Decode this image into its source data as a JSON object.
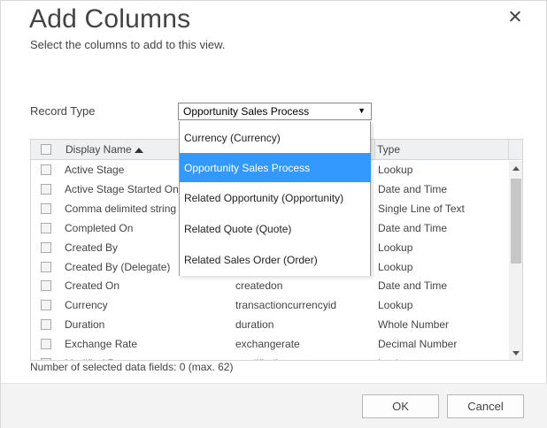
{
  "dialog": {
    "title": "Add Columns",
    "subtitle": "Select the columns to add to this view.",
    "close_icon": "close-icon"
  },
  "record_type": {
    "label": "Record Type",
    "selected": "Opportunity Sales Process",
    "options": [
      "Currency (Currency)",
      "Opportunity Sales Process",
      "Related Opportunity (Opportunity)",
      "Related Quote (Quote)",
      "Related Sales Order (Order)"
    ]
  },
  "grid": {
    "headers": {
      "display_name": "Display Name",
      "type": "Type"
    },
    "rows": [
      {
        "name": "Active Stage",
        "schema": "",
        "type": "Lookup"
      },
      {
        "name": "Active Stage Started On",
        "schema": "",
        "type": "Date and Time"
      },
      {
        "name": "Comma delimited string",
        "schema": "",
        "type": "Single Line of Text"
      },
      {
        "name": "Completed On",
        "schema": "",
        "type": "Date and Time"
      },
      {
        "name": "Created By",
        "schema": "",
        "type": "Lookup"
      },
      {
        "name": "Created By (Delegate)",
        "schema": "",
        "type": "Lookup"
      },
      {
        "name": "Created On",
        "schema": "createdon",
        "type": "Date and Time"
      },
      {
        "name": "Currency",
        "schema": "transactioncurrencyid",
        "type": "Lookup"
      },
      {
        "name": "Duration",
        "schema": "duration",
        "type": "Whole Number"
      },
      {
        "name": "Exchange Rate",
        "schema": "exchangerate",
        "type": "Decimal Number"
      },
      {
        "name": "Modified By",
        "schema": "modifiedby",
        "type": "Lookup"
      }
    ]
  },
  "summary": "Number of selected data fields: 0 (max. 62)",
  "footer": {
    "ok_label": "OK",
    "cancel_label": "Cancel"
  },
  "colors": {
    "selected_option": "#3399ff",
    "footer_bg": "#f3f3f3",
    "header_bg": "#eef0f2"
  }
}
